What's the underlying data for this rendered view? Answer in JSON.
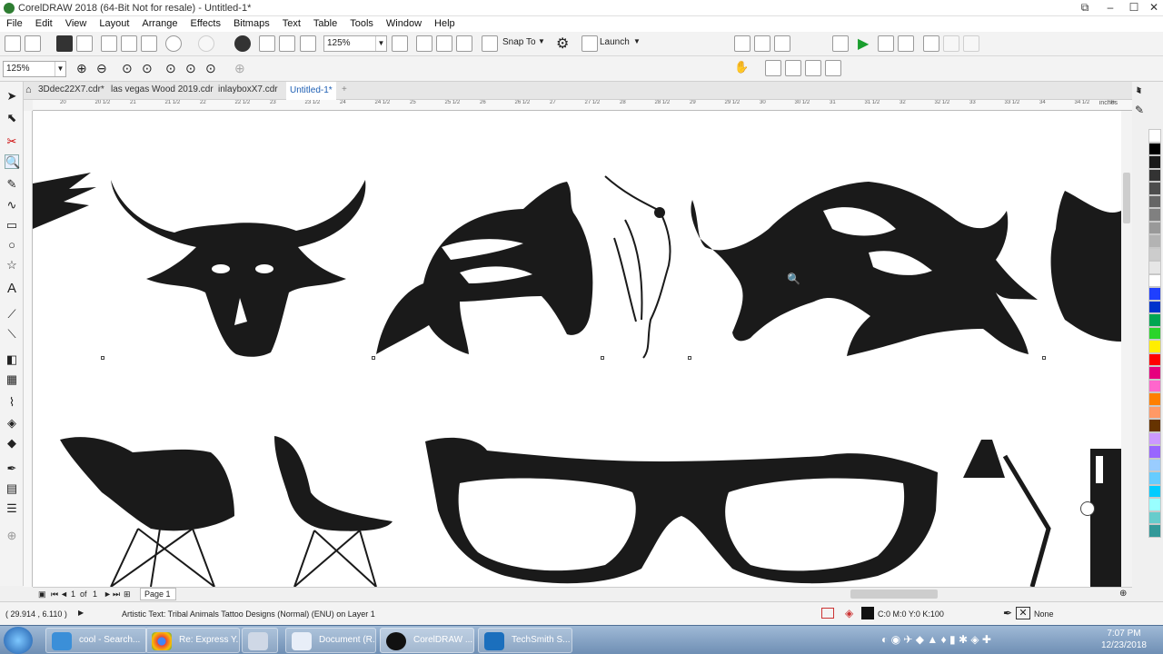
{
  "window": {
    "title": "CorelDRAW 2018 (64-Bit Not for resale) - Untitled-1*"
  },
  "menu": [
    "File",
    "Edit",
    "View",
    "Layout",
    "Arrange",
    "Effects",
    "Bitmaps",
    "Text",
    "Table",
    "Tools",
    "Window",
    "Help"
  ],
  "toolbar": {
    "zoom_value": "125%",
    "snap_label": "Snap To",
    "launch_label": "Launch"
  },
  "propertybar": {
    "zoom_value": "125%"
  },
  "tabs": [
    {
      "label": "3Ddec22X7.cdr*"
    },
    {
      "label": "las vegas Wood 2019.cdr"
    },
    {
      "label": "inlayboxX7.cdr"
    },
    {
      "label": "Untitled-1*"
    }
  ],
  "ruler": {
    "unit": "inches",
    "ticks": [
      "20",
      "20 1/2",
      "21",
      "21 1/2",
      "22",
      "22 1/2",
      "23",
      "23 1/2",
      "24",
      "24 1/2",
      "25",
      "25 1/2",
      "26",
      "26 1/2",
      "27",
      "27 1/2",
      "28",
      "28 1/2",
      "29",
      "29 1/2",
      "30",
      "30 1/2",
      "31",
      "31 1/2",
      "32",
      "32 1/2",
      "33",
      "33 1/2",
      "34",
      "34 1/2",
      "35",
      "35 1/2"
    ]
  },
  "pagebar": {
    "current": "1",
    "of": "of",
    "total": "1",
    "page_label": "Page 1"
  },
  "status": {
    "coords": "( 29.914 , 6.110 )",
    "message": "Artistic Text: Tribal Animals Tattoo Designs (Normal) (ENU) on Layer 1",
    "fill": "C:0 M:0 Y:0 K:100",
    "outline": "None"
  },
  "palette": [
    "#ffffff",
    "#000000",
    "#1a1a1a",
    "#333333",
    "#4d4d4d",
    "#666666",
    "#808080",
    "#999999",
    "#b3b3b3",
    "#cccccc",
    "#e6e6e6",
    "#ffffff",
    "#1f3fff",
    "#0033cc",
    "#00a651",
    "#2bd42b",
    "#ffee00",
    "#ff0000",
    "#e6007e",
    "#ff66cc",
    "#ff7f00",
    "#ff9966",
    "#663300",
    "#cc99ff",
    "#9966ff",
    "#99ccff",
    "#66ccff",
    "#00ccff",
    "#99ffff",
    "#66cccc",
    "#339999"
  ],
  "taskbar": {
    "tasks": [
      {
        "label": "cool - Search..."
      },
      {
        "label": "Re: Express Y..."
      },
      {
        "label": ""
      },
      {
        "label": "Document (R..."
      },
      {
        "label": "CorelDRAW ..."
      },
      {
        "label": "TechSmith S..."
      }
    ],
    "time": "7:07 PM",
    "date": "12/23/2018"
  }
}
